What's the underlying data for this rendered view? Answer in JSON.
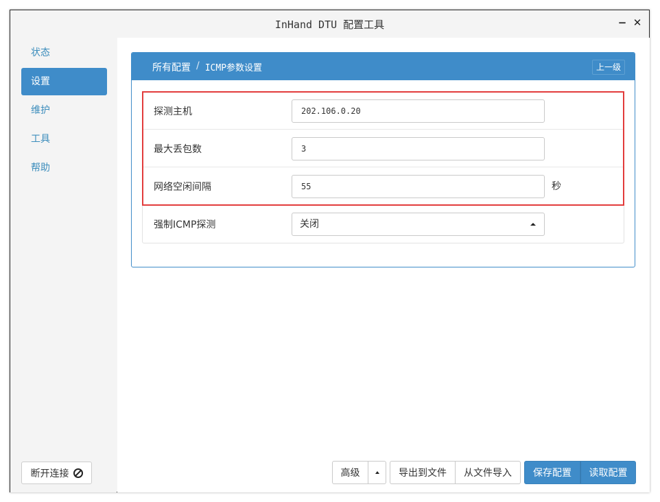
{
  "window": {
    "title": "InHand DTU 配置工具",
    "minimize_glyph": "−",
    "close_glyph": "✕"
  },
  "sidebar": {
    "items": [
      {
        "label": "状态"
      },
      {
        "label": "设置",
        "active": true
      },
      {
        "label": "维护"
      },
      {
        "label": "工具"
      },
      {
        "label": "帮助"
      }
    ],
    "disconnect_label": "断开连接",
    "disconnect_icon": "ban-icon"
  },
  "panel": {
    "breadcrumb": {
      "root": "所有配置",
      "separator": "/",
      "current": "ICMP参数设置"
    },
    "up_button": "上一级"
  },
  "form": {
    "rows": [
      {
        "label": "探测主机",
        "value": "202.106.0.20"
      },
      {
        "label": "最大丢包数",
        "value": "3"
      },
      {
        "label": "网络空闲间隔",
        "value": "55",
        "unit": "秒"
      },
      {
        "label": "强制ICMP探测",
        "value": "关闭",
        "type": "select"
      }
    ]
  },
  "footer": {
    "advanced": "高级",
    "export": "导出到文件",
    "import": "从文件导入",
    "save": "保存配置",
    "read": "读取配置"
  },
  "colors": {
    "accent": "#3f8cc9",
    "highlight": "#e23b3b"
  }
}
